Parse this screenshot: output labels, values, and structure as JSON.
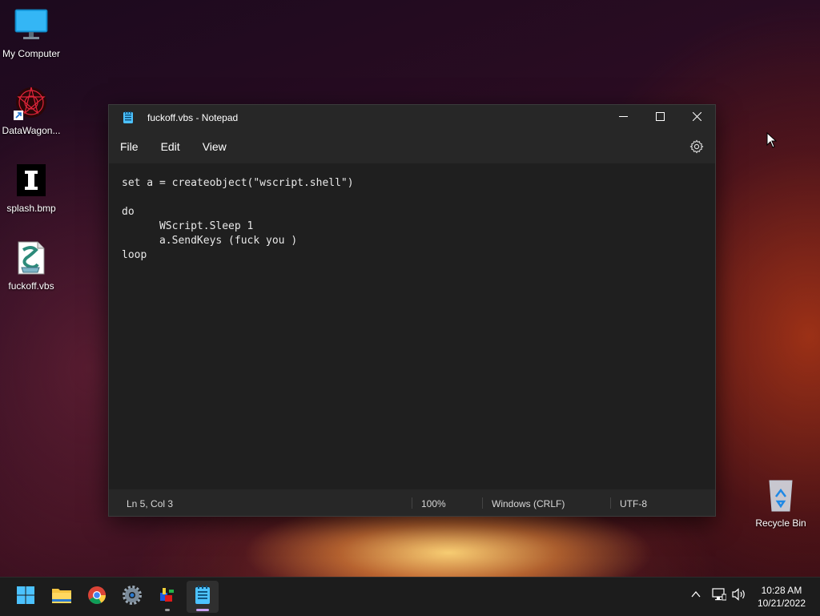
{
  "desktop": {
    "icons": [
      {
        "label": "My Computer",
        "icon": "monitor-icon"
      },
      {
        "label": "DataWagon...",
        "icon": "datawagon-shortcut-icon"
      },
      {
        "label": "splash.bmp",
        "icon": "bitmap-file-icon"
      },
      {
        "label": "fuckoff.vbs",
        "icon": "vbs-script-icon"
      },
      {
        "label": "Recycle Bin",
        "icon": "recycle-bin-icon"
      }
    ]
  },
  "notepad": {
    "title": "fuckoff.vbs - Notepad",
    "menu": [
      "File",
      "Edit",
      "View"
    ],
    "content": "set a = createobject(\"wscript.shell\")\n\ndo\n      WScript.Sleep 1\n      a.SendKeys (fuck you )\nloop",
    "status": {
      "position": "Ln 5, Col 3",
      "zoom": "100%",
      "line_ending": "Windows (CRLF)",
      "encoding": "UTF-8"
    }
  },
  "taskbar": {
    "apps": [
      "start-icon",
      "file-explorer-icon",
      "chrome-icon",
      "settings-icon",
      "paint-app-icon",
      "notepad-icon"
    ],
    "clock": {
      "time": "10:28 AM",
      "date": "10/21/2022"
    }
  },
  "colors": {
    "accent": "#4cc2ff",
    "window_bg": "#272727",
    "editor_bg": "#1f1f1f",
    "taskbar_bg": "#1c1c1c"
  }
}
